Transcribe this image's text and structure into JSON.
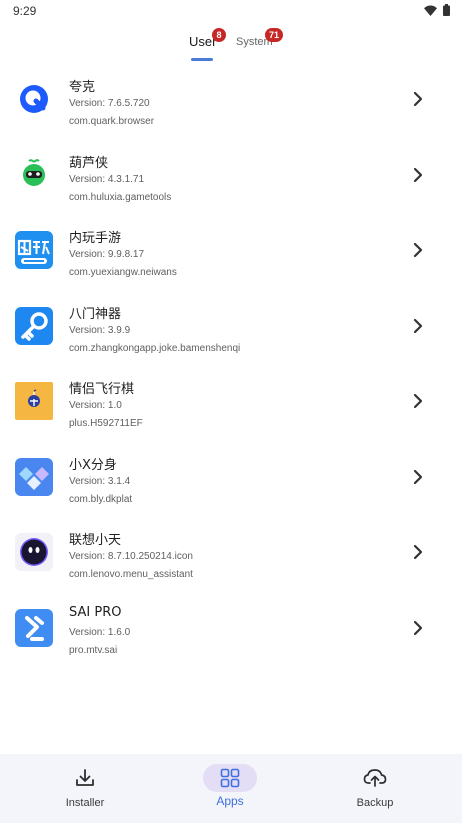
{
  "status_bar": {
    "time": "9:29",
    "icons": [
      "wifi-icon",
      "battery-icon"
    ]
  },
  "tabs": [
    {
      "label": "User",
      "badge": "8",
      "active": true
    },
    {
      "label": "System",
      "badge": "71",
      "active": false
    }
  ],
  "apps": [
    {
      "name": "夸克",
      "version": "Version: 7.6.5.720",
      "package": "com.quark.browser",
      "icon": "quark-icon",
      "color": "#1e5bff"
    },
    {
      "name": "葫芦侠",
      "version": "Version: 4.3.1.71",
      "package": "com.huluxia.gametools",
      "icon": "huluxia-icon",
      "color": "#2bbf5a"
    },
    {
      "name": "内玩手游",
      "version": "Version: 9.9.8.17",
      "package": "com.yuexiangw.neiwans",
      "icon": "neiwan-icon",
      "color": "#1f8ff0"
    },
    {
      "name": "八门神器",
      "version": "Version: 3.9.9",
      "package": "com.zhangkongapp.joke.bamenshenqi",
      "icon": "key-icon",
      "color": "#1e88f0"
    },
    {
      "name": "情侣飞行棋",
      "version": "Version: 1.0",
      "package": "plus.H592711EF",
      "icon": "flight-chess-icon",
      "color": "#f5b642"
    },
    {
      "name": "小X分身",
      "version": "Version: 3.1.4",
      "package": "com.bly.dkplat",
      "icon": "xiaox-icon",
      "color": "#4a86f0"
    },
    {
      "name": "联想小天",
      "version": "Version: 8.7.10.250214.icon",
      "package": "com.lenovo.menu_assistant",
      "icon": "lenovo-xiaotian-icon",
      "color": "#2a2140"
    },
    {
      "name": "SAI PRO",
      "version": "Version: 1.6.0",
      "package": "pro.mtv.sai",
      "icon": "sai-icon",
      "color": "#3f8cf2"
    }
  ],
  "bottom_nav": {
    "installer": "Installer",
    "apps": "Apps",
    "backup": "Backup"
  },
  "colors": {
    "accent": "#3f6fe0",
    "badge": "#c62828",
    "nav_background": "#f3f5fa",
    "nav_active_pill": "#e3ddf5"
  }
}
